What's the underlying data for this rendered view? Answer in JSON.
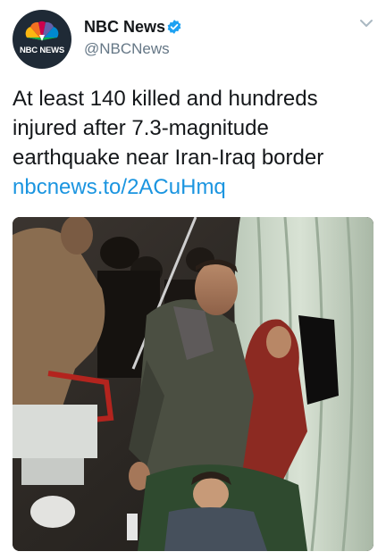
{
  "tweet": {
    "author": {
      "display_name": "NBC News",
      "handle": "@NBCNews",
      "verified": true,
      "avatar_icon": "nbc-peacock-icon",
      "avatar_text": "NBC NEWS"
    },
    "text_lines": [
      "At least 140 killed and hundreds",
      "injured after 7.3-magnitude",
      "earthquake near Iran-Iraq border"
    ],
    "link": "nbcnews.to/2ACuHmq",
    "menu_icon": "chevron-down-icon",
    "media_icon": "photo-icon"
  },
  "colors": {
    "link": "#1b95e0",
    "verified": "#1da1f2",
    "handle": "#657786",
    "text": "#14171a"
  }
}
